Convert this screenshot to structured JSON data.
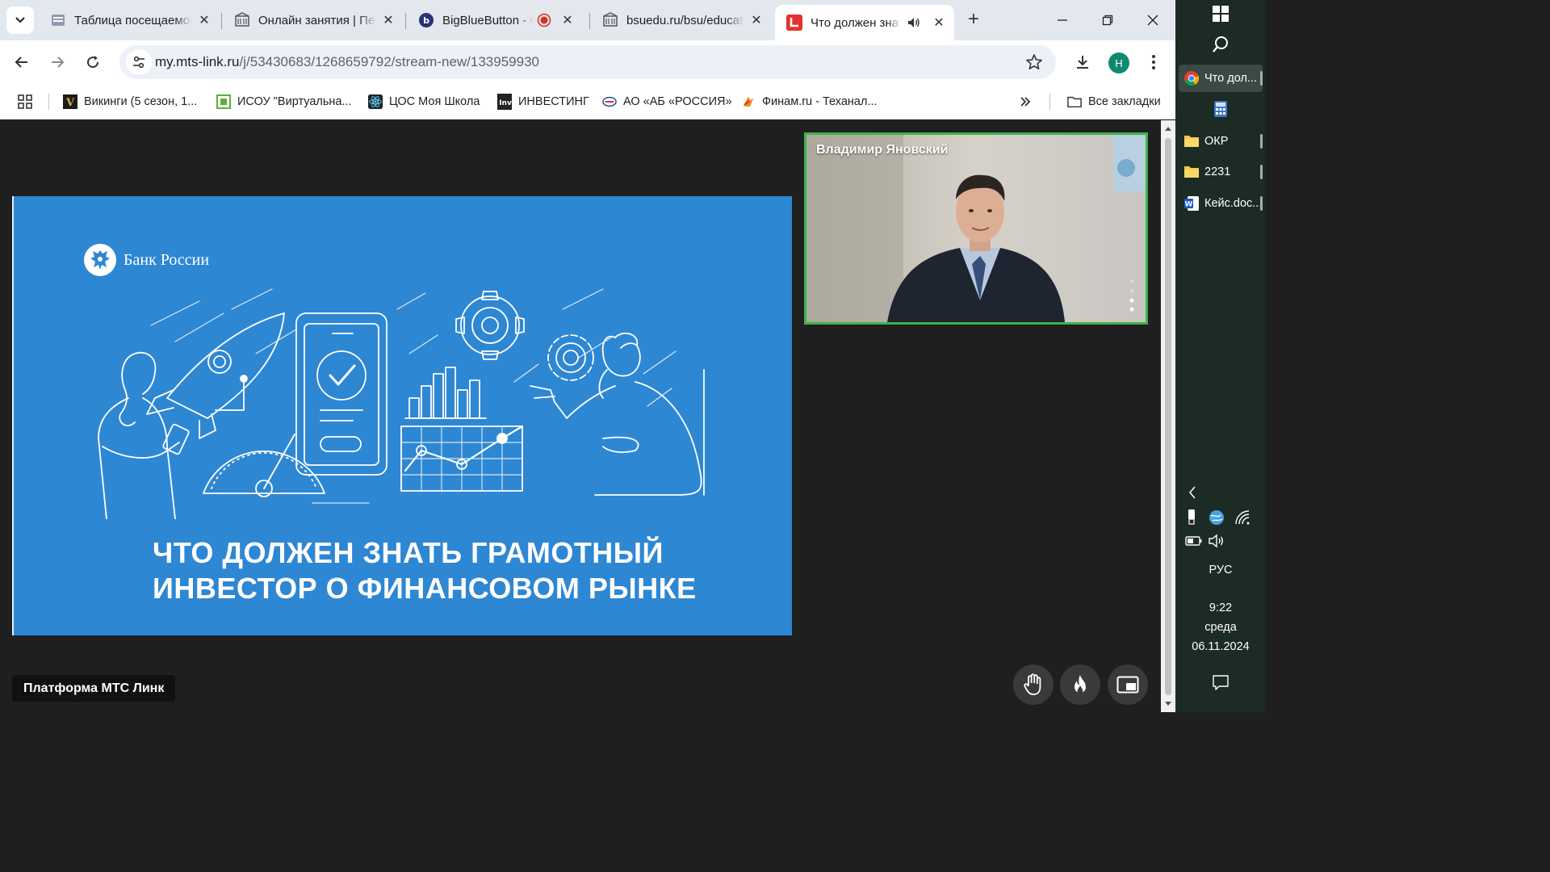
{
  "tabs": [
    {
      "title": "Таблица посещаемости",
      "icon": "spreadsheet-icon"
    },
    {
      "title": "Онлайн занятия | Пе",
      "icon": "building-icon"
    },
    {
      "title": "BigBlueButton - С",
      "icon": "bigbluebutton-icon"
    },
    {
      "title": "bsuedu.ru/bsu/educat",
      "icon": "building-icon"
    },
    {
      "title": "Что должен знать",
      "icon": "mts-link-icon",
      "active": true
    }
  ],
  "toolbar": {
    "url_host": "my.mts-link.ru",
    "url_path": "/j/53430683/1268659792/stream-new/133959930",
    "profile_initial": "Н"
  },
  "bookmarks": [
    {
      "label": "Викинги (5 сезон, 1...",
      "icon": "vikings-icon"
    },
    {
      "label": "ИСОУ \"Виртуальна...",
      "icon": "isou-icon"
    },
    {
      "label": "ЦОС Моя Школа",
      "icon": "react-icon"
    },
    {
      "label": "ИНВЕСТИНГ",
      "icon": "investing-icon"
    },
    {
      "label": "АО «АБ «РОССИЯ»",
      "icon": "bank-icon"
    },
    {
      "label": "Финам.ru - Теханал...",
      "icon": "finam-icon"
    }
  ],
  "all_bookmarks": "Все закладки",
  "slide": {
    "brand": "Банк России",
    "headline_line1": "ЧТО ДОЛЖЕН ЗНАТЬ ГРАМОТНЫЙ",
    "headline_line2": "ИНВЕСТОР О ФИНАНСОВОМ РЫНКЕ",
    "bg_color": "#2e87d3"
  },
  "speaker": {
    "name": "Владимир Яновский",
    "border_color": "#3fb24a"
  },
  "platform_label": "Платформа МТС Линк",
  "taskbar": {
    "chrome_item": "Что дол...",
    "folders": [
      "ОКР",
      "2231"
    ],
    "document": "Кейс.doc...",
    "lang": "РУС",
    "time": "9:22",
    "weekday": "среда",
    "date": "06.11.2024"
  }
}
